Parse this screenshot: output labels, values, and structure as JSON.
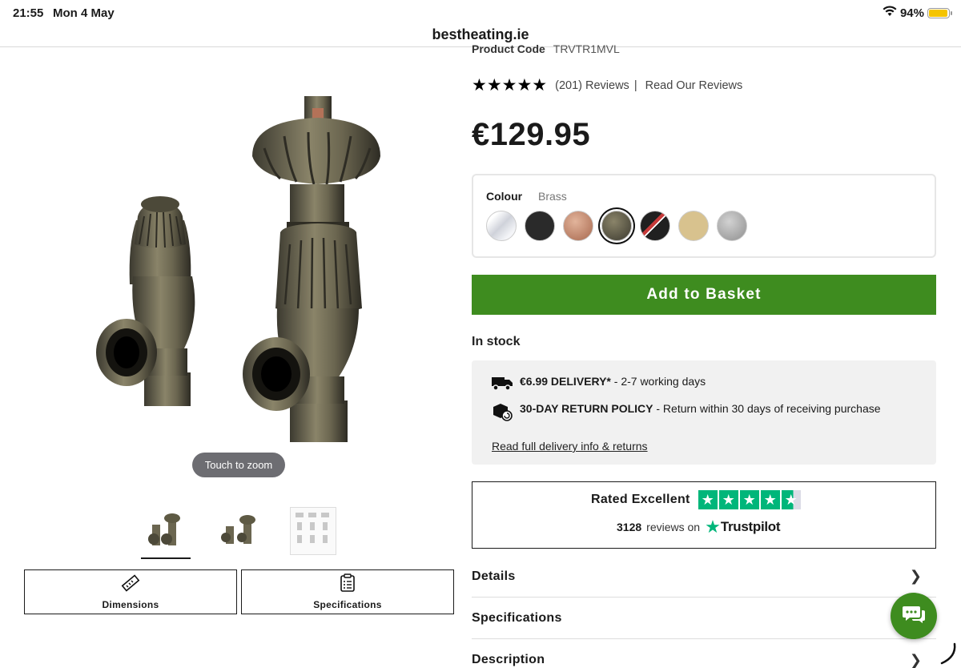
{
  "status": {
    "time": "21:55",
    "date": "Mon 4 May",
    "battery": "94%",
    "battery_level": 0.94
  },
  "browser": {
    "url": "bestheating.ie"
  },
  "gallery": {
    "zoom_hint": "Touch to zoom",
    "thumbnails": [
      "valve-angled",
      "valve-straight",
      "spec-sheet"
    ],
    "buttons": {
      "dimensions": "Dimensions",
      "specifications": "Specifications"
    }
  },
  "product": {
    "code_label": "Product Code",
    "code": "TRVTR1MVL",
    "rating": 5,
    "review_count": "(201) Reviews",
    "read_reviews": "Read Our Reviews",
    "price": "€129.95"
  },
  "colour": {
    "label": "Colour",
    "selected": "Brass",
    "swatches": [
      {
        "name": "chrome",
        "color": "#e8e9ee"
      },
      {
        "name": "black",
        "color": "#2a2a2a"
      },
      {
        "name": "copper",
        "color": "#c48a6d"
      },
      {
        "name": "brass",
        "color": "#5e5a44"
      },
      {
        "name": "black-red",
        "color": "#202020"
      },
      {
        "name": "gold",
        "color": "#d8c28e"
      },
      {
        "name": "pewter",
        "color": "#a8a8a8"
      }
    ]
  },
  "cta": {
    "add_to_basket": "Add to Basket",
    "accent": "#3e8c1f"
  },
  "stock": "In stock",
  "delivery": {
    "shipping_title": "€6.99 DELIVERY*",
    "shipping_text": " - 2-7 working days",
    "returns_title": "30-DAY RETURN POLICY",
    "returns_text": " - Return within 30 days of receiving purchase",
    "link": "Read full delivery info & returns"
  },
  "trustpilot": {
    "rated": "Rated Excellent",
    "count": "3128",
    "reviews_on": "reviews on",
    "brand": "Trustpilot",
    "stars": 4.5
  },
  "accordion": [
    "Details",
    "Specifications",
    "Description"
  ]
}
